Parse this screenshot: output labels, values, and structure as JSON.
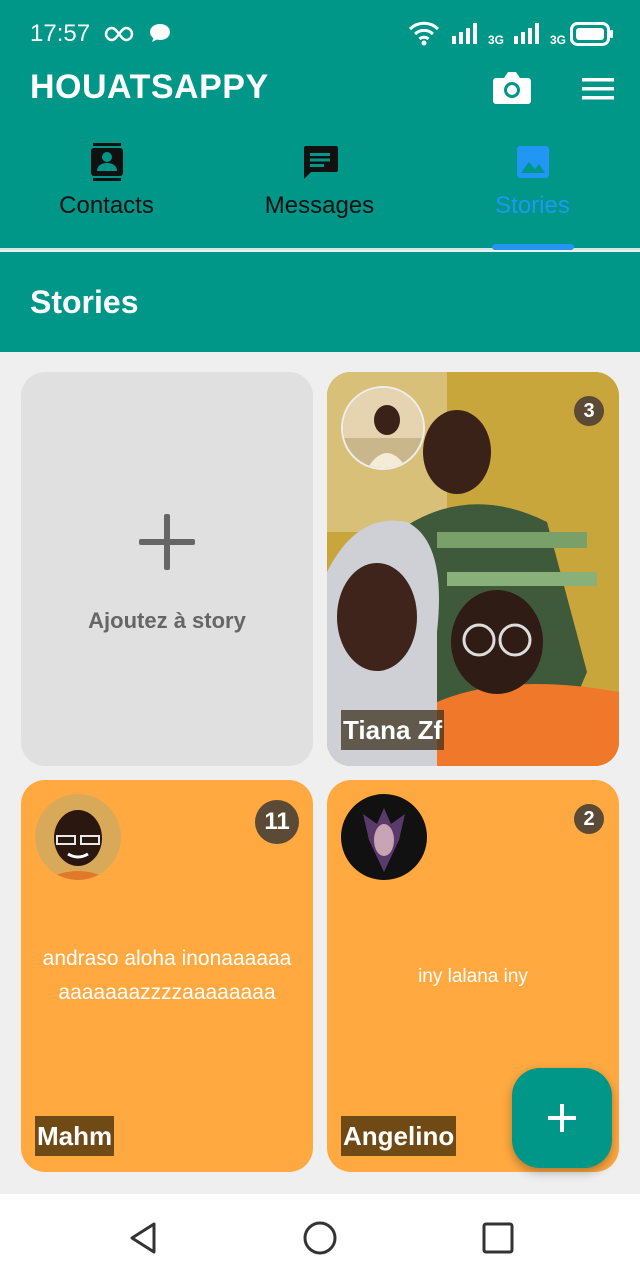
{
  "status_bar": {
    "time": "17:57",
    "network_1": "3G",
    "network_2": "3G"
  },
  "app": {
    "title": "HOUATSAPPY"
  },
  "tabs": [
    {
      "label": "Contacts",
      "icon": "contacts-icon",
      "active": false
    },
    {
      "label": "Messages",
      "icon": "chat-icon",
      "active": false
    },
    {
      "label": "Stories",
      "icon": "image-icon",
      "active": true
    }
  ],
  "section": {
    "title": "Stories"
  },
  "add_story": {
    "label": "Ajoutez à story"
  },
  "stories": [
    {
      "name": "Tiana Zf",
      "count": "3",
      "type": "photo"
    },
    {
      "name": "Mahm",
      "count": "11",
      "type": "text",
      "text": "andraso aloha inonaaaaaa aaaaaaazzzzaaaaaaaa"
    },
    {
      "name": "Angelino",
      "count": "2",
      "type": "text",
      "text": "iny lalana iny"
    }
  ],
  "colors": {
    "primary": "#009688",
    "accent": "#2196f3",
    "story_bg": "#ffa940"
  }
}
